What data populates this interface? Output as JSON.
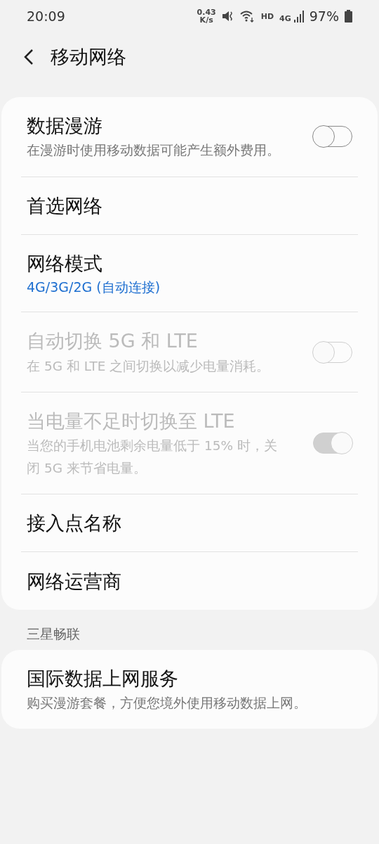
{
  "status_bar": {
    "time": "20:09",
    "speed_value": "0.43",
    "speed_unit": "K/s",
    "hd": "HD",
    "network": "4G",
    "battery": "97%"
  },
  "header": {
    "title": "移动网络"
  },
  "groups": [
    {
      "items": [
        {
          "kind": "toggle",
          "title": "数据漫游",
          "subtitle": "在漫游时使用移动数据可能产生额外费用。",
          "disabled": false,
          "on": false
        },
        {
          "kind": "link",
          "title": "首选网络",
          "disabled": false
        },
        {
          "kind": "value",
          "title": "网络模式",
          "value": "4G/3G/2G (自动连接)",
          "disabled": false
        },
        {
          "kind": "toggle",
          "title": "自动切换 5G 和 LTE",
          "subtitle": "在 5G 和 LTE 之间切换以减少电量消耗。",
          "disabled": true,
          "on": false
        },
        {
          "kind": "toggle",
          "title": "当电量不足时切换至 LTE",
          "subtitle": "当您的手机电池剩余电量低于 15% 时，关闭 5G 来节省电量。",
          "disabled": true,
          "on": true
        },
        {
          "kind": "link",
          "title": "接入点名称",
          "disabled": false
        },
        {
          "kind": "link",
          "title": "网络运营商",
          "disabled": false
        }
      ]
    },
    {
      "heading": "三星畅联",
      "items": [
        {
          "kind": "link",
          "title": "国际数据上网服务",
          "subtitle": "购买漫游套餐，方便您境外使用移动数据上网。",
          "disabled": false
        }
      ]
    }
  ]
}
